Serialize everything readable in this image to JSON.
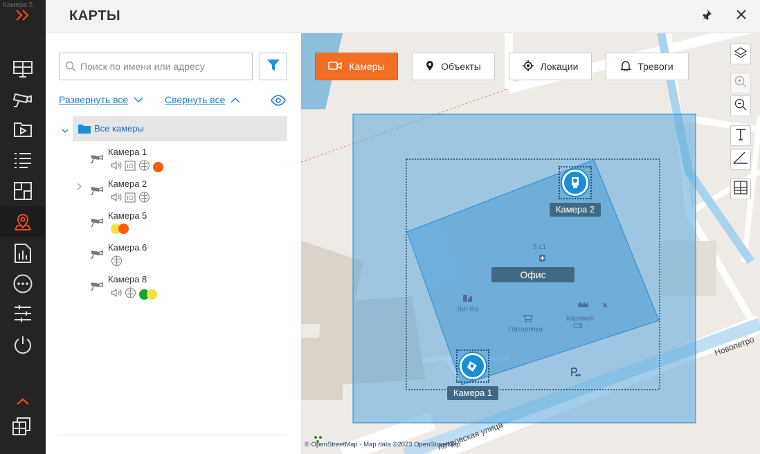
{
  "window": {
    "title": "КАРТЫ",
    "ghost_label": "Камера 5"
  },
  "header": {
    "pin_icon": "pin-icon",
    "close_icon": "close-icon"
  },
  "rail": {
    "items": [
      {
        "name": "expand-rail-icon",
        "active": false
      },
      {
        "name": "monitor-layout-icon",
        "active": false
      },
      {
        "name": "camera-icon",
        "active": false
      },
      {
        "name": "archive-play-icon",
        "active": false
      },
      {
        "name": "event-list-icon",
        "active": false
      },
      {
        "name": "layout-plan-icon",
        "active": false
      },
      {
        "name": "map-pin-icon",
        "active": true
      },
      {
        "name": "report-icon",
        "active": false
      },
      {
        "name": "more-icon",
        "active": false
      },
      {
        "name": "settings-sliders-icon",
        "active": false
      },
      {
        "name": "power-icon",
        "active": false
      },
      {
        "name": "chevron-up-icon",
        "active": false
      },
      {
        "name": "windows-icon",
        "active": false
      }
    ],
    "accent": "#f24c1c"
  },
  "search": {
    "placeholder": "Поиск по имени или адресу",
    "value": ""
  },
  "tree_actions": {
    "expand_all": "Развернуть все",
    "collapse_all": "Свернуть все"
  },
  "tree": {
    "root_label": "Все камеры",
    "cameras": [
      {
        "name": "Камера 1",
        "expandable": false,
        "icons": [
          "speaker-icon",
          "io-icon",
          "brain-icon"
        ],
        "dots": [
          "#ff5a00"
        ]
      },
      {
        "name": "Камера 2",
        "expandable": true,
        "icons": [
          "speaker-icon",
          "io-icon",
          "brain-icon"
        ],
        "dots": []
      },
      {
        "name": "Камера 5",
        "expandable": false,
        "icons": [],
        "dots": [
          "#ffe03a",
          "#ff5a00"
        ]
      },
      {
        "name": "Камера 6",
        "expandable": false,
        "icons": [
          "brain-icon"
        ],
        "dots": []
      },
      {
        "name": "Камера 8",
        "expandable": false,
        "icons": [
          "speaker-icon",
          "brain-icon"
        ],
        "dots": [
          "#14a62b",
          "#ffe03a"
        ]
      }
    ]
  },
  "map": {
    "tabs": [
      {
        "label": "Камеры",
        "icon": "video-camera-icon",
        "active": true
      },
      {
        "label": "Объекты",
        "icon": "location-pin-icon",
        "active": false
      },
      {
        "label": "Локации",
        "icon": "target-icon",
        "active": false
      },
      {
        "label": "Тревоги",
        "icon": "bell-icon",
        "active": false
      }
    ],
    "tools": [
      {
        "name": "layers-icon",
        "enabled": true
      },
      {
        "name": "zoom-in-icon",
        "enabled": false
      },
      {
        "name": "zoom-out-icon",
        "enabled": true
      },
      {
        "name": "text-tool-icon",
        "enabled": true
      },
      {
        "name": "angle-tool-icon",
        "enabled": true
      },
      {
        "name": "grid-tool-icon",
        "enabled": true
      }
    ],
    "labels": {
      "camera1": "Камера 1",
      "camera2": "Камера 2",
      "office": "Офис"
    },
    "pois": {
      "building_num": "3 с1",
      "poi1": "Лит.Ra",
      "poi2": "Пятерочка",
      "poi3": "Каравай-СВ"
    },
    "streets": {
      "street1": "Новопетро",
      "street2": "петровская улица"
    },
    "attribution": "© OpenStreetMap - Map data ©2023 OpenStreetMap",
    "accent": "#f26e22",
    "zone_color": "#1a8fd5"
  }
}
